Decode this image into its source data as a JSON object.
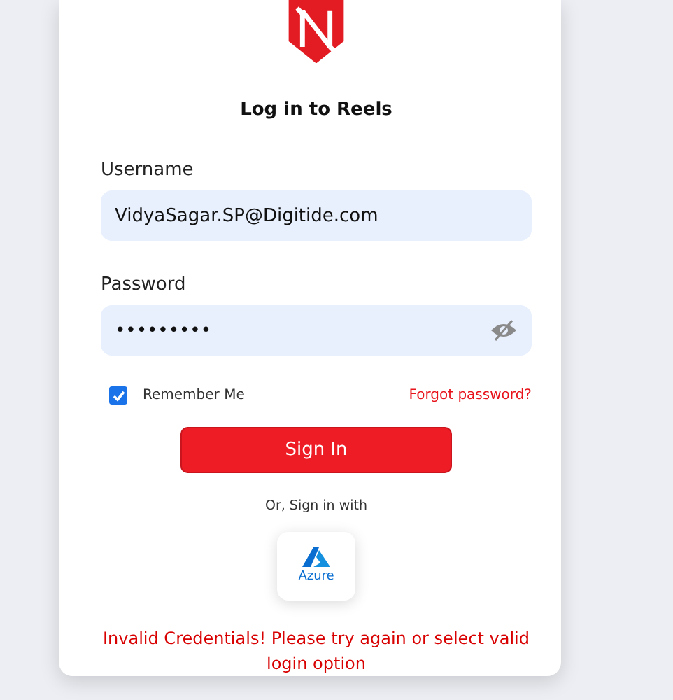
{
  "title": "Log in to Reels",
  "username": {
    "label": "Username",
    "value": "VidyaSagar.SP@Digitide.com"
  },
  "password": {
    "label": "Password",
    "value": "•••••••••"
  },
  "remember_me": {
    "label": "Remember Me",
    "checked": true
  },
  "forgot_password": "Forgot password?",
  "sign_in_button": "Sign In",
  "alt_sign_in": {
    "label": "Or, Sign in with",
    "providers": [
      {
        "name": "Azure"
      }
    ]
  },
  "error": "Invalid Credentials! Please try again or select valid login option"
}
